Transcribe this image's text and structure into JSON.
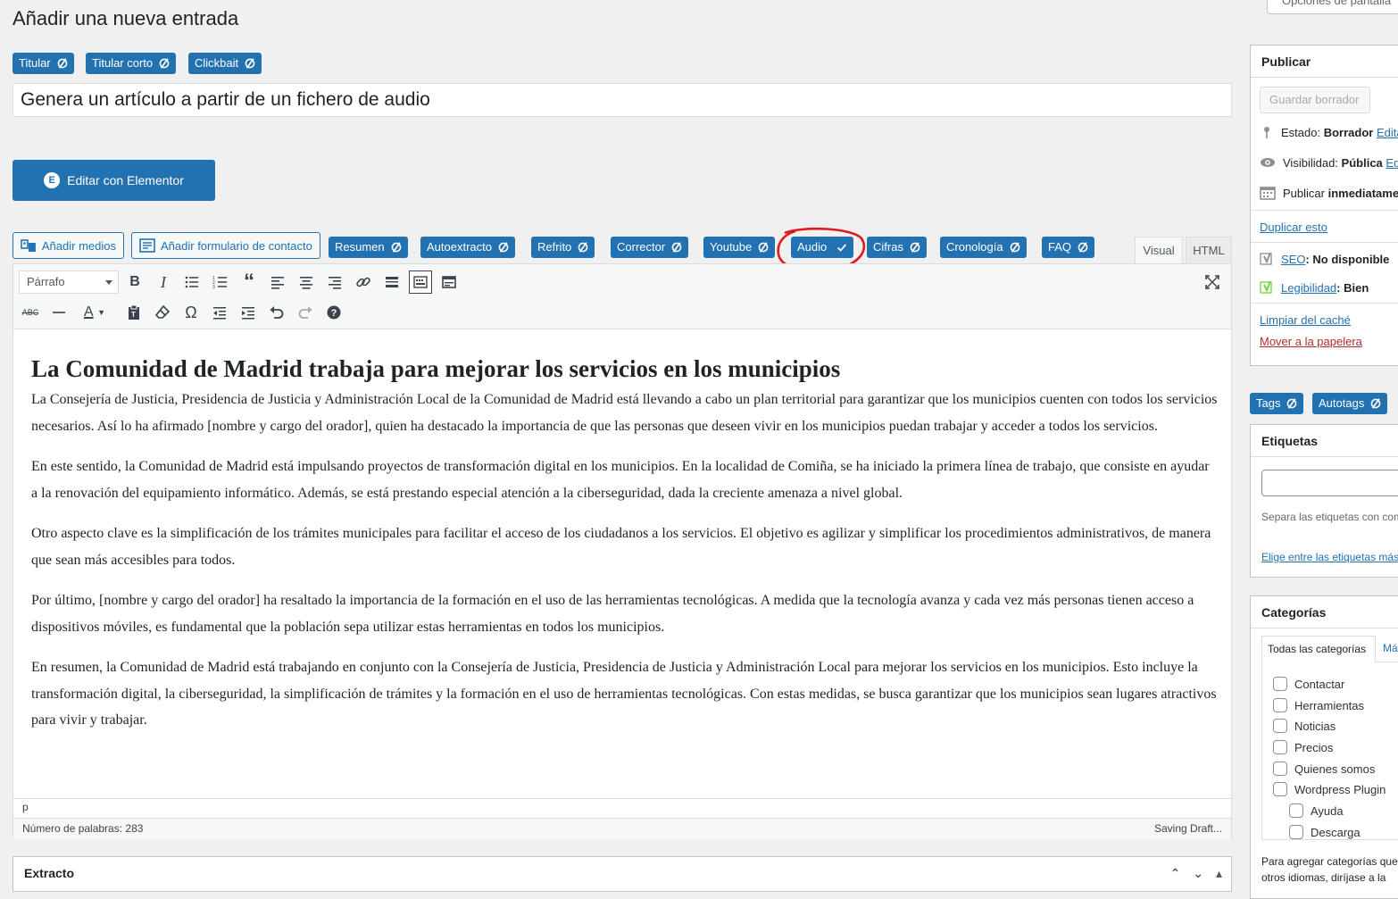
{
  "page": {
    "title": "Añadir una nueva entrada",
    "screen_options": "Opciones de pantalla"
  },
  "title_tools": [
    {
      "label": "Titular"
    },
    {
      "label": "Titular corto"
    },
    {
      "label": "Clickbait"
    }
  ],
  "post_title": "Genera un artículo a partir de un fichero de audio",
  "elementor": {
    "label": "Editar con Elementor"
  },
  "media": {
    "add_media": "Añadir medios",
    "add_form": "Añadir formulario de contacto"
  },
  "content_tools": [
    {
      "label": "Resumen",
      "icon": "refresh-icon"
    },
    {
      "label": "Autoextracto",
      "icon": "refresh-icon"
    },
    {
      "label": "Refrito",
      "icon": "refresh-icon"
    },
    {
      "label": "Corrector",
      "icon": "refresh-icon"
    },
    {
      "label": "Youtube",
      "icon": "refresh-icon"
    },
    {
      "label": "Audio",
      "icon": "check-icon"
    },
    {
      "label": "Cifras",
      "icon": "refresh-icon"
    },
    {
      "label": "Cronología",
      "icon": "refresh-icon"
    },
    {
      "label": "FAQ",
      "icon": "refresh-icon"
    }
  ],
  "editor_tabs": {
    "visual": "Visual",
    "html": "HTML"
  },
  "toolbar": {
    "format": "Párrafo"
  },
  "content": {
    "heading": "La Comunidad de Madrid trabaja para mejorar los servicios en los municipios",
    "paragraphs": [
      "La Consejería de Justicia, Presidencia de Justicia y Administración Local de la Comunidad de Madrid está llevando a cabo un plan territorial para garantizar que los municipios cuenten con todos los servicios necesarios. Así lo ha afirmado [nombre y cargo del orador], quien ha destacado la importancia de que las personas que deseen vivir en los municipios puedan trabajar y acceder a todos los servicios.",
      "En este sentido, la Comunidad de Madrid está impulsando proyectos de transformación digital en los municipios. En la localidad de Comiña, se ha iniciado la primera línea de trabajo, que consiste en ayudar a la renovación del equipamiento informático. Además, se está prestando especial atención a la ciberseguridad, dada la creciente amenaza a nivel global.",
      "Otro aspecto clave es la simplificación de los trámites municipales para facilitar el acceso de los ciudadanos a los servicios. El objetivo es agilizar y simplificar los procedimientos administrativos, de manera que sean más accesibles para todos.",
      "Por último, [nombre y cargo del orador] ha resaltado la importancia de la formación en el uso de las herramientas tecnológicas. A medida que la tecnología avanza y cada vez más personas tienen acceso a dispositivos móviles, es fundamental que la población sepa utilizar estas herramientas en todos los municipios.",
      "En resumen, la Comunidad de Madrid está trabajando en conjunto con la Consejería de Justicia, Presidencia de Justicia y Administración Local para mejorar los servicios en los municipios. Esto incluye la transformación digital, la ciberseguridad, la simplificación de trámites y la formación en el uso de herramientas tecnológicas. Con estas medidas, se busca garantizar que los municipios sean lugares atractivos para vivir y trabajar."
    ]
  },
  "status": {
    "path": "p",
    "word_count": "Número de palabras: 283",
    "saving": "Saving Draft..."
  },
  "extracto": {
    "title": "Extracto"
  },
  "publish": {
    "title": "Publicar",
    "save_draft": "Guardar borrador",
    "estado_label": "Estado:",
    "estado_value": "Borrador",
    "estado_edit": "Editar",
    "visibilidad_label": "Visibilidad:",
    "visibilidad_value": "Pública",
    "visibilidad_edit": "Editar",
    "publicar_label": "Publicar",
    "publicar_value": "inmediatamente",
    "duplicate": "Duplicar esto",
    "seo_label": "SEO",
    "seo_value": ": No disponible",
    "legibilidad_label": "Legibilidad",
    "legibilidad_value": ": Bien",
    "clear_cache": "Limpiar del caché",
    "trash": "Mover a la papelera"
  },
  "tag_tools": [
    {
      "label": "Tags"
    },
    {
      "label": "Autotags"
    }
  ],
  "etiquetas": {
    "title": "Etiquetas",
    "help": "Separa las etiquetas con comas",
    "choose": "Elige entre las etiquetas más utilizadas"
  },
  "categorias": {
    "title": "Categorías",
    "tab_all": "Todas las categorías",
    "tab_more": "Más utilizadas",
    "items": [
      {
        "label": "Contactar",
        "child": false
      },
      {
        "label": "Herramientas",
        "child": false
      },
      {
        "label": "Noticias",
        "child": false
      },
      {
        "label": "Precios",
        "child": false
      },
      {
        "label": "Quienes somos",
        "child": false
      },
      {
        "label": "Wordpress Plugin",
        "child": false
      },
      {
        "label": "Ayuda",
        "child": true
      },
      {
        "label": "Descarga",
        "child": true
      }
    ],
    "footer_1": "Para agregar categorías que",
    "footer_2": "otros idiomas, diríjase a la"
  }
}
